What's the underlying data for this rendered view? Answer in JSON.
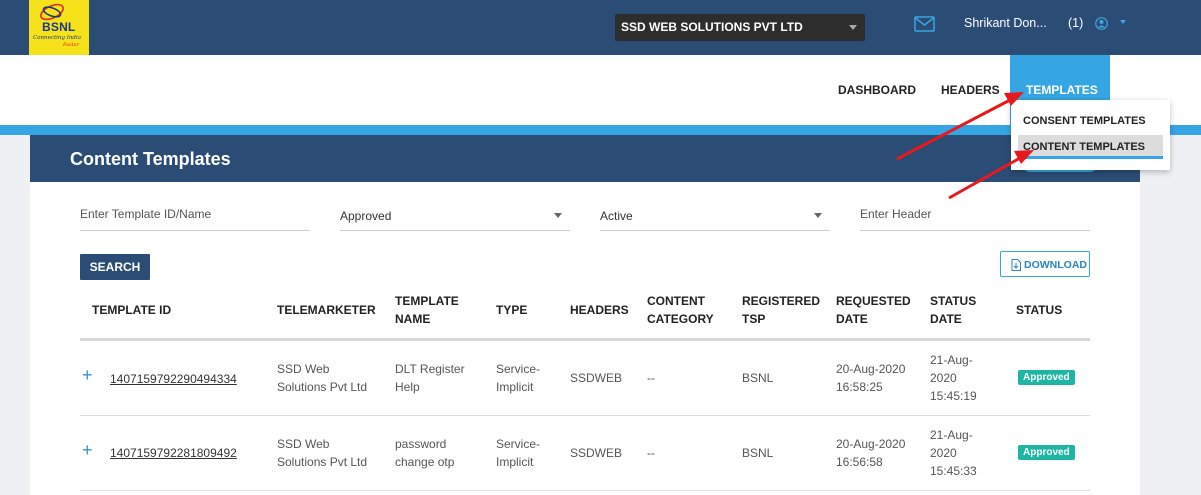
{
  "brand": {
    "name": "BSNL",
    "tagline": "Connecting India",
    "tagline2": "Faster"
  },
  "header": {
    "org": "SSD WEB SOLUTIONS PVT LTD",
    "user_name": "Shrikant Don...",
    "user_count": "(1)"
  },
  "nav": {
    "dashboard": "DASHBOARD",
    "headers": "HEADERS",
    "templates": "TEMPLATES"
  },
  "templates_menu": {
    "consent": "CONSENT TEMPLATES",
    "content": "CONTENT TEMPLATES"
  },
  "page": {
    "title": "Content Templates"
  },
  "filters": {
    "template_placeholder": "Enter Template ID/Name",
    "approval_status": "Approved",
    "active_status": "Active",
    "header_placeholder": "Enter Header"
  },
  "actions": {
    "search": "SEARCH",
    "download": "DOWNLOAD"
  },
  "table": {
    "columns": {
      "template_id": "TEMPLATE ID",
      "telemarketer": "TELEMARKETER",
      "template_name_1": "TEMPLATE",
      "template_name_2": "NAME",
      "type": "TYPE",
      "headers": "HEADERS",
      "content_category_1": "CONTENT",
      "content_category_2": "CATEGORY",
      "registered_tsp_1": "REGISTERED",
      "registered_tsp_2": "TSP",
      "requested_date_1": "REQUESTED",
      "requested_date_2": "DATE",
      "status_date_1": "STATUS",
      "status_date_2": "DATE",
      "status": "STATUS"
    },
    "rows": [
      {
        "expand": "+",
        "template_id": "1407159792290494334",
        "telemarketer_1": "SSD Web",
        "telemarketer_2": "Solutions Pvt Ltd",
        "name_1": "DLT Register",
        "name_2": "Help",
        "type_1": "Service-",
        "type_2": "Implicit",
        "headers": "SSDWEB",
        "category": "--",
        "tsp": "BSNL",
        "requested_1": "20-Aug-2020",
        "requested_2": "16:58:25",
        "status_date_1": "21-Aug-",
        "status_date_2": "2020",
        "status_date_3": "15:45:19",
        "status": "Approved"
      },
      {
        "expand": "+",
        "template_id": "1407159792281809492",
        "telemarketer_1": "SSD Web",
        "telemarketer_2": "Solutions Pvt Ltd",
        "name_1": "password",
        "name_2": "change otp",
        "type_1": "Service-",
        "type_2": "Implicit",
        "headers": "SSDWEB",
        "category": "--",
        "tsp": "BSNL",
        "requested_1": "20-Aug-2020",
        "requested_2": "16:56:58",
        "status_date_1": "21-Aug-",
        "status_date_2": "2020",
        "status_date_3": "15:45:33",
        "status": "Approved"
      }
    ]
  },
  "colors": {
    "navy": "#2b4c74",
    "accent_blue": "#35a5e4",
    "approved_badge": "#1fb5a5",
    "annotation_arrow": "#e8191c"
  }
}
